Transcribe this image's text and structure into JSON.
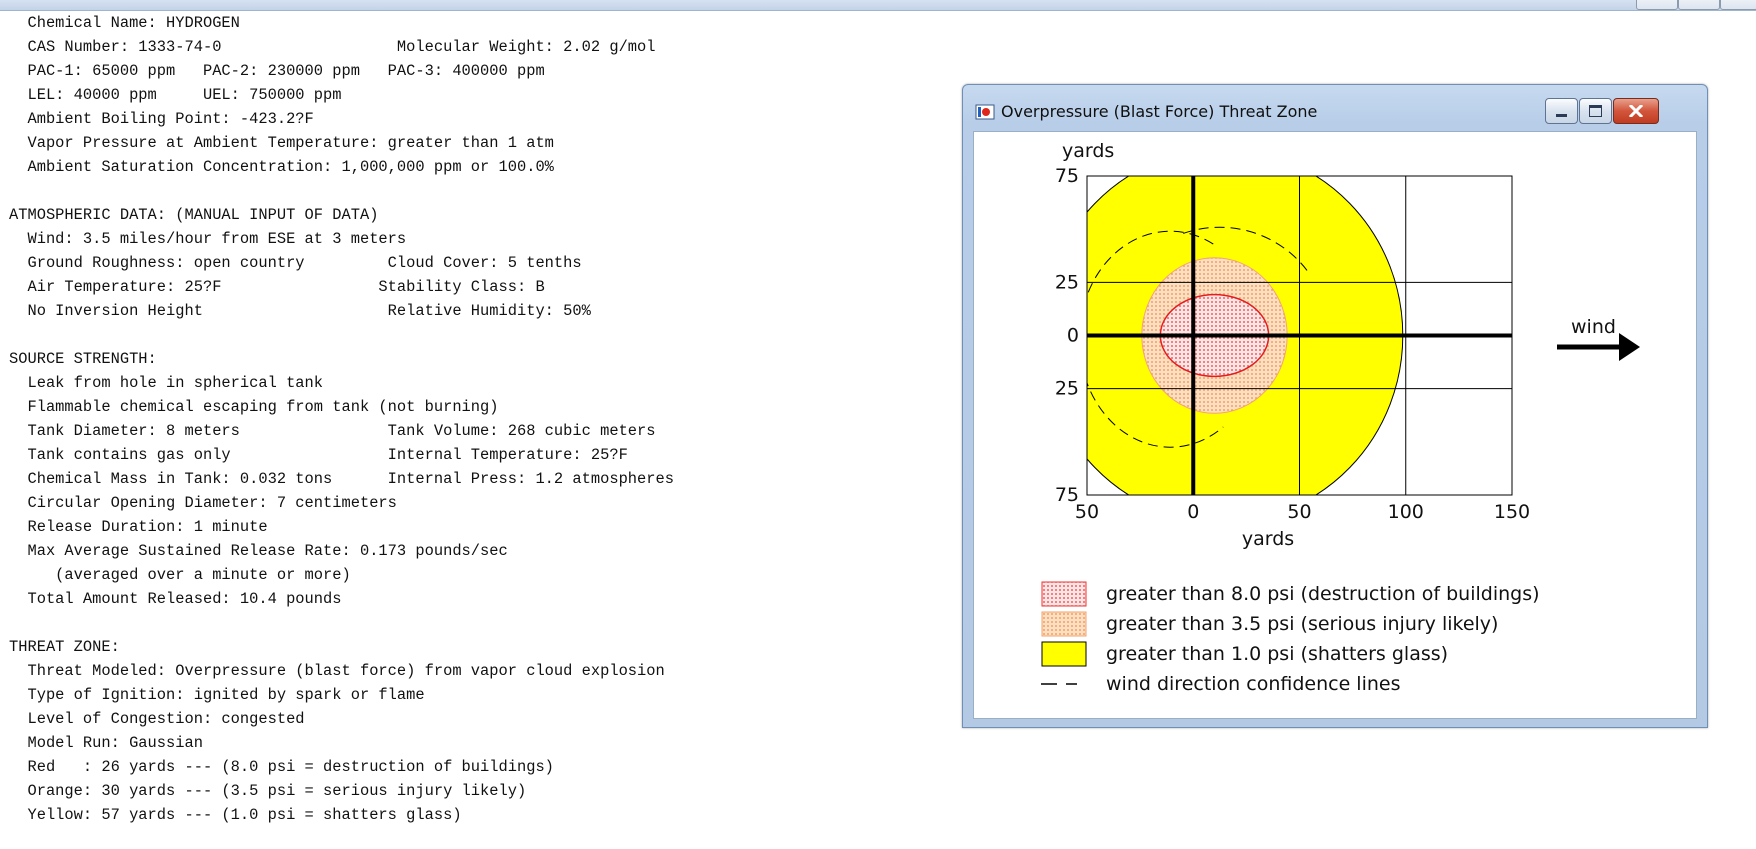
{
  "report_lines": [
    "Chemical Name: HYDROGEN",
    "CAS Number: 1333-74-0                   Molecular Weight: 2.02 g/mol",
    "PAC-1: 65000 ppm   PAC-2: 230000 ppm   PAC-3: 400000 ppm",
    "LEL: 40000 ppm     UEL: 750000 ppm",
    "Ambient Boiling Point: -423.2?F",
    "Vapor Pressure at Ambient Temperature: greater than 1 atm",
    "Ambient Saturation Concentration: 1,000,000 ppm or 100.0%",
    "",
    "ATMOSPHERIC DATA: (MANUAL INPUT OF DATA)",
    "  Wind: 3.5 miles/hour from ESE at 3 meters",
    "  Ground Roughness: open country         Cloud Cover: 5 tenths",
    "  Air Temperature: 25?F                 Stability Class: B",
    "  No Inversion Height                    Relative Humidity: 50%",
    "",
    "SOURCE STRENGTH:",
    "  Leak from hole in spherical tank",
    "  Flammable chemical escaping from tank (not burning)",
    "  Tank Diameter: 8 meters                Tank Volume: 268 cubic meters",
    "  Tank contains gas only                 Internal Temperature: 25?F",
    "  Chemical Mass in Tank: 0.032 tons      Internal Press: 1.2 atmospheres",
    "  Circular Opening Diameter: 7 centimeters",
    "  Release Duration: 1 minute",
    "  Max Average Sustained Release Rate: 0.173 pounds/sec",
    "     (averaged over a minute or more)",
    "  Total Amount Released: 10.4 pounds",
    "",
    "THREAT ZONE:",
    "  Threat Modeled: Overpressure (blast force) from vapor cloud explosion",
    "  Type of Ignition: ignited by spark or flame",
    "  Level of Congestion: congested",
    "  Model Run: Gaussian",
    "  Red   : 26 yards --- (8.0 psi = destruction of buildings)",
    "  Orange: 30 yards --- (3.5 psi = serious injury likely)",
    "  Yellow: 57 yards --- (1.0 psi = shatters glass)"
  ],
  "window": {
    "title": "Overpressure (Blast Force) Threat Zone"
  },
  "chart_data": {
    "type": "threat-zone-plot",
    "x_unit_label": "yards",
    "y_unit_label": "yards",
    "x_ticks": [
      "50",
      "0",
      "50",
      "100",
      "150"
    ],
    "y_ticks": [
      "75",
      "25",
      "0",
      "25",
      "75"
    ],
    "xlim": [
      -50,
      150
    ],
    "ylim": [
      -75,
      75
    ],
    "wind_label": "wind",
    "zones": [
      {
        "name": "Red",
        "psi": 8.0,
        "radius_yards": 26,
        "color": "#ff3b3b"
      },
      {
        "name": "Orange",
        "psi": 3.5,
        "radius_yards": 30,
        "color": "#f9b98a"
      },
      {
        "name": "Yellow",
        "psi": 1.0,
        "radius_yards": 57,
        "color": "#ffff00"
      }
    ],
    "legend": [
      {
        "label": "greater than 8.0 psi (destruction of buildings)",
        "swatch": "red-dotted"
      },
      {
        "label": "greater than 3.5 psi (serious injury likely)",
        "swatch": "orange-dotted"
      },
      {
        "label": "greater than 1.0 psi (shatters glass)",
        "swatch": "yellow-solid"
      },
      {
        "label": "wind direction confidence lines",
        "swatch": "dashed-line"
      }
    ],
    "grid": true
  }
}
